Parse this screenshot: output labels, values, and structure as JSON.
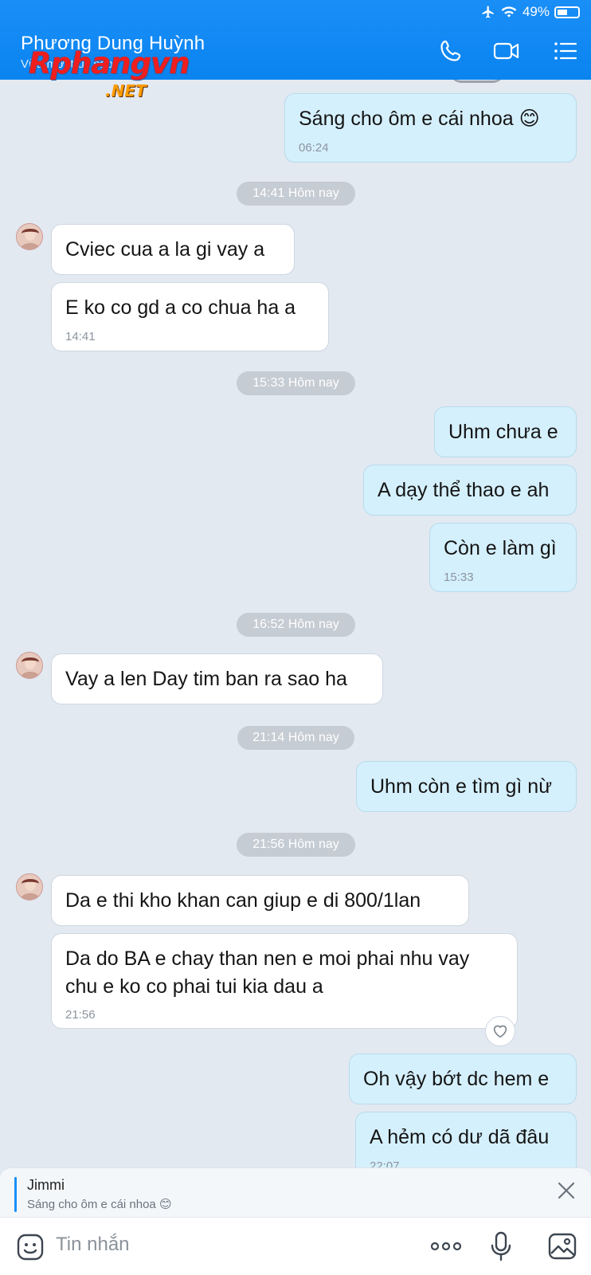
{
  "status": {
    "battery": "49%",
    "airplane_icon": "airplane-icon",
    "wifi_icon": "wifi-icon"
  },
  "header": {
    "contact_name": "Phương Dung Huỳnh",
    "subtitle": "Vừa mới truy cập",
    "call_icon": "phone-icon",
    "video_icon": "video-camera-icon",
    "menu_icon": "list-menu-icon"
  },
  "watermark": {
    "main": "Rphangvn",
    "suffix": ".NET"
  },
  "messages": [
    {
      "dir": "out",
      "text": "Sáng cho ôm e cái nhoa 😊",
      "time": "06:24"
    },
    {
      "sep": "14:41 Hôm nay"
    },
    {
      "dir": "in",
      "text": "Cviec cua a la gi vay a"
    },
    {
      "dir": "in",
      "text": "E ko co gd a co chua ha a",
      "time": "14:41"
    },
    {
      "sep": "15:33 Hôm nay"
    },
    {
      "dir": "out",
      "text": "Uhm chưa e"
    },
    {
      "dir": "out",
      "text": "A dạy thể thao e ah"
    },
    {
      "dir": "out",
      "text": "Còn e làm gì",
      "time": "15:33"
    },
    {
      "sep": "16:52 Hôm nay"
    },
    {
      "dir": "in",
      "text": "Vay a len Day tim ban ra sao ha"
    },
    {
      "sep": "21:14 Hôm nay"
    },
    {
      "dir": "out",
      "text": "Uhm còn e tìm gì nừ"
    },
    {
      "sep": "21:56 Hôm nay"
    },
    {
      "dir": "in",
      "text": "Da e thi kho khan can giup e di 800/1lan"
    },
    {
      "dir": "in",
      "text": "Da do BA e chay than nen e moi phai nhu vay chu e ko co phai tui kia dau a",
      "time": "21:56"
    },
    {
      "dir": "out",
      "text": "Oh vậy bớt dc hem e"
    },
    {
      "dir": "out",
      "text": "A hẻm có dư dã đâu",
      "time": "22:07"
    }
  ],
  "reply_preview": {
    "name": "Jimmi",
    "text": "Sáng cho ôm e cái nhoa 😊",
    "close_icon": "close-icon"
  },
  "composer": {
    "placeholder": "Tin nhắn",
    "emoji_icon": "emoji-icon",
    "more_icon": "more-dots-icon",
    "mic_icon": "microphone-icon",
    "image_icon": "image-icon"
  },
  "colors": {
    "header": "#0a84f0",
    "outgoing": "#d5f0fd",
    "incoming": "#ffffff",
    "background": "#e2e9f1"
  }
}
